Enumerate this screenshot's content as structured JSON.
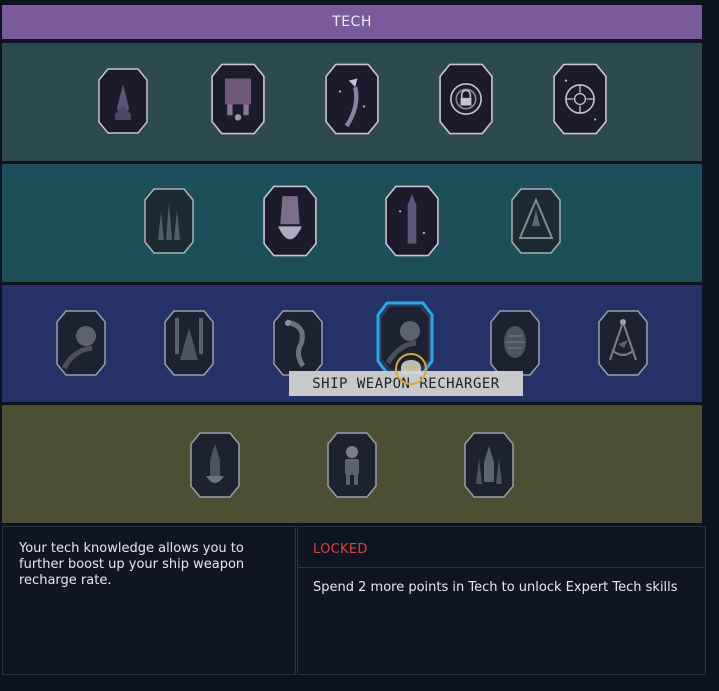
{
  "header": {
    "title": "TECH"
  },
  "tiers": [
    {
      "skills": [
        {
          "icon": "rocket-silhouette-icon"
        },
        {
          "icon": "rocket-thrusters-icon"
        },
        {
          "icon": "missile-trail-icon"
        },
        {
          "icon": "targeting-lock-icon"
        },
        {
          "icon": "crosshair-reticle-icon"
        }
      ]
    },
    {
      "skills": [
        {
          "icon": "spires-icon"
        },
        {
          "icon": "ship-thruster-icon"
        },
        {
          "icon": "rocket-column-icon"
        },
        {
          "icon": "shield-rocket-icon"
        }
      ]
    },
    {
      "skills": [
        {
          "icon": "planet-orbit-icon"
        },
        {
          "icon": "ship-wings-icon"
        },
        {
          "icon": "robot-arm-icon"
        },
        {
          "icon": "weapon-recharger-icon",
          "selected": true
        },
        {
          "icon": "spaceship-pod-icon"
        },
        {
          "icon": "compass-ship-icon"
        }
      ]
    },
    {
      "skills": [
        {
          "icon": "rocket-launch-icon"
        },
        {
          "icon": "astronaut-icon"
        },
        {
          "icon": "rocket-towers-icon"
        }
      ]
    }
  ],
  "tooltip": {
    "text": "SHIP WEAPON RECHARGER"
  },
  "details": {
    "description": "Your tech knowledge allows you to further boost up your ship weapon recharge rate.",
    "status": "LOCKED",
    "requirement": "Spend 2 more points in Tech to unlock Expert Tech skills"
  },
  "colors": {
    "header": "#7a5a9a",
    "tier1": "#2d4a52",
    "tier2": "#1d4f5b",
    "tier3": "#25326a",
    "tier4": "#4d4f33",
    "selected_outline": "#2aa7e6",
    "locked": "#e0403e"
  }
}
